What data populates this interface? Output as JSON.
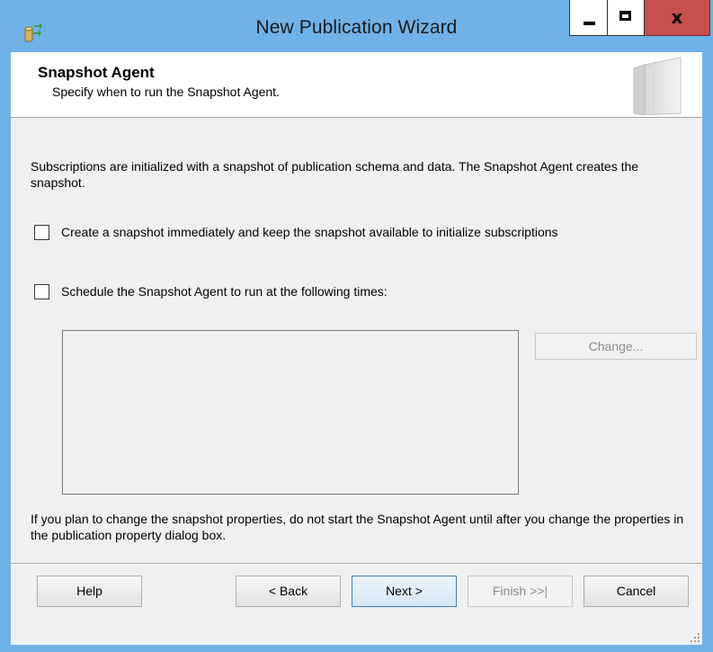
{
  "window": {
    "title": "New Publication Wizard",
    "minimize_icon": "minimize-icon",
    "maximize_icon": "maximize-icon",
    "close_glyph": "x",
    "app_icon": "publication-wizard-icon",
    "close_color": "#c7504b",
    "frame_color": "#6fb2e8"
  },
  "header": {
    "title": "Snapshot Agent",
    "subtitle": "Specify when to run the Snapshot Agent.",
    "graphic": "wizard-book-graphic"
  },
  "content": {
    "intro": "Subscriptions are initialized with a snapshot of publication schema and data. The Snapshot Agent creates the snapshot.",
    "create_snapshot": {
      "label": "Create a snapshot immediately and keep the snapshot available to initialize subscriptions",
      "checked": false
    },
    "schedule_agent": {
      "label": "Schedule the Snapshot Agent to run at the following times:",
      "checked": false
    },
    "schedule_text": "",
    "change_button": "Change...",
    "note": "If you plan to change the snapshot properties, do not start the Snapshot Agent until after you change the properties in the publication property dialog box."
  },
  "footer": {
    "help": "Help",
    "back": "< Back",
    "next": "Next >",
    "finish": "Finish >>|",
    "cancel": "Cancel"
  }
}
